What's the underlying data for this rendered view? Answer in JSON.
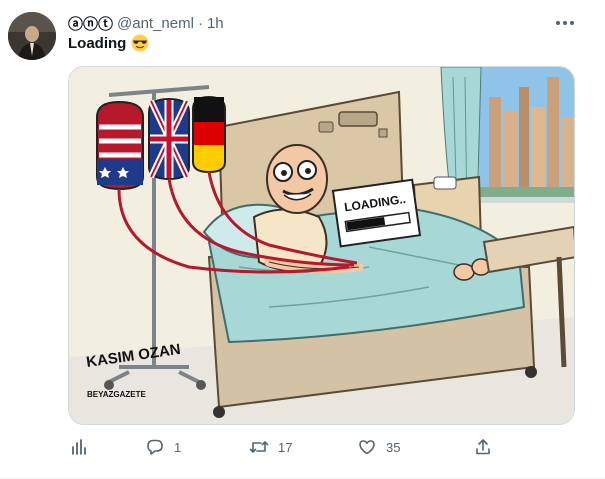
{
  "author": {
    "display_name": "ⓐⓝⓣ",
    "handle": "@ant_neml",
    "separator": "·",
    "time": "1h"
  },
  "tweet": {
    "text": "Loading"
  },
  "media": {
    "sign_text": "LOADING..",
    "signature_name": "KASIM OZAN",
    "signature_outlet": "BEYAZGAZETE"
  },
  "actions": {
    "replies": "1",
    "retweets": "17",
    "likes": "35"
  },
  "icons": [
    "analytics-icon",
    "reply-icon",
    "retweet-icon",
    "like-icon",
    "share-icon",
    "more-icon",
    "sunglasses-emoji"
  ],
  "colors": {
    "text_primary": "#0f1419",
    "text_secondary": "#536471",
    "border": "#cfd9de"
  }
}
